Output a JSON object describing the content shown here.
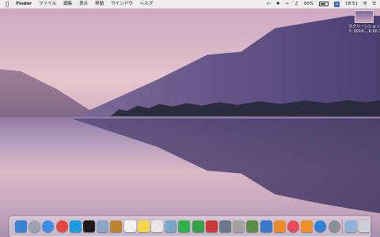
{
  "menubar": {
    "app_name": "Finder",
    "menus": [
      "ファイル",
      "編集",
      "表示",
      "移動",
      "ウインドウ",
      "ヘルプ"
    ],
    "battery": "83%",
    "user_badge": "A",
    "clock": "18:51"
  },
  "desktop": {
    "screenshot_label_1": "スクリーンショッ",
    "screenshot_label_2": "ト 2014....6.00.16"
  },
  "dock": {
    "apps": [
      {
        "name": "finder",
        "color": "#3b82d6"
      },
      {
        "name": "launchpad",
        "color": "#9aa3ae"
      },
      {
        "name": "safari",
        "color": "#3a8ee6"
      },
      {
        "name": "chrome",
        "color": "#e2483b"
      },
      {
        "name": "twitter",
        "color": "#1e9be0"
      },
      {
        "name": "terminal",
        "color": "#1a1a1a"
      },
      {
        "name": "preview",
        "color": "#8aa5c7"
      },
      {
        "name": "notes",
        "color": "#b8862f"
      },
      {
        "name": "calendar",
        "color": "#f2f2f2"
      },
      {
        "name": "stickies",
        "color": "#f0d84a"
      },
      {
        "name": "text-edit",
        "color": "#e8e8e8"
      },
      {
        "name": "preview-2",
        "color": "#7aa7c9"
      },
      {
        "name": "messages",
        "color": "#2fb04b"
      },
      {
        "name": "facetime",
        "color": "#39a04a"
      },
      {
        "name": "photo-booth",
        "color": "#c93a3a"
      },
      {
        "name": "image-capture",
        "color": "#6a7a8a"
      },
      {
        "name": "font-book",
        "color": "#a2a2a2"
      },
      {
        "name": "iphoto",
        "color": "#5a8e46"
      },
      {
        "name": "keynote",
        "color": "#3a79c9"
      },
      {
        "name": "pages",
        "color": "#e88a2e"
      },
      {
        "name": "itunes",
        "color": "#e94b5a"
      },
      {
        "name": "ibooks",
        "color": "#f0902a"
      },
      {
        "name": "app-store",
        "color": "#2d83d8"
      },
      {
        "name": "system-preferences",
        "color": "#8a8f96"
      },
      {
        "name": "downloads-folder",
        "color": "#8fb3d6"
      },
      {
        "name": "trash",
        "color": "#c9d0d6"
      }
    ]
  }
}
